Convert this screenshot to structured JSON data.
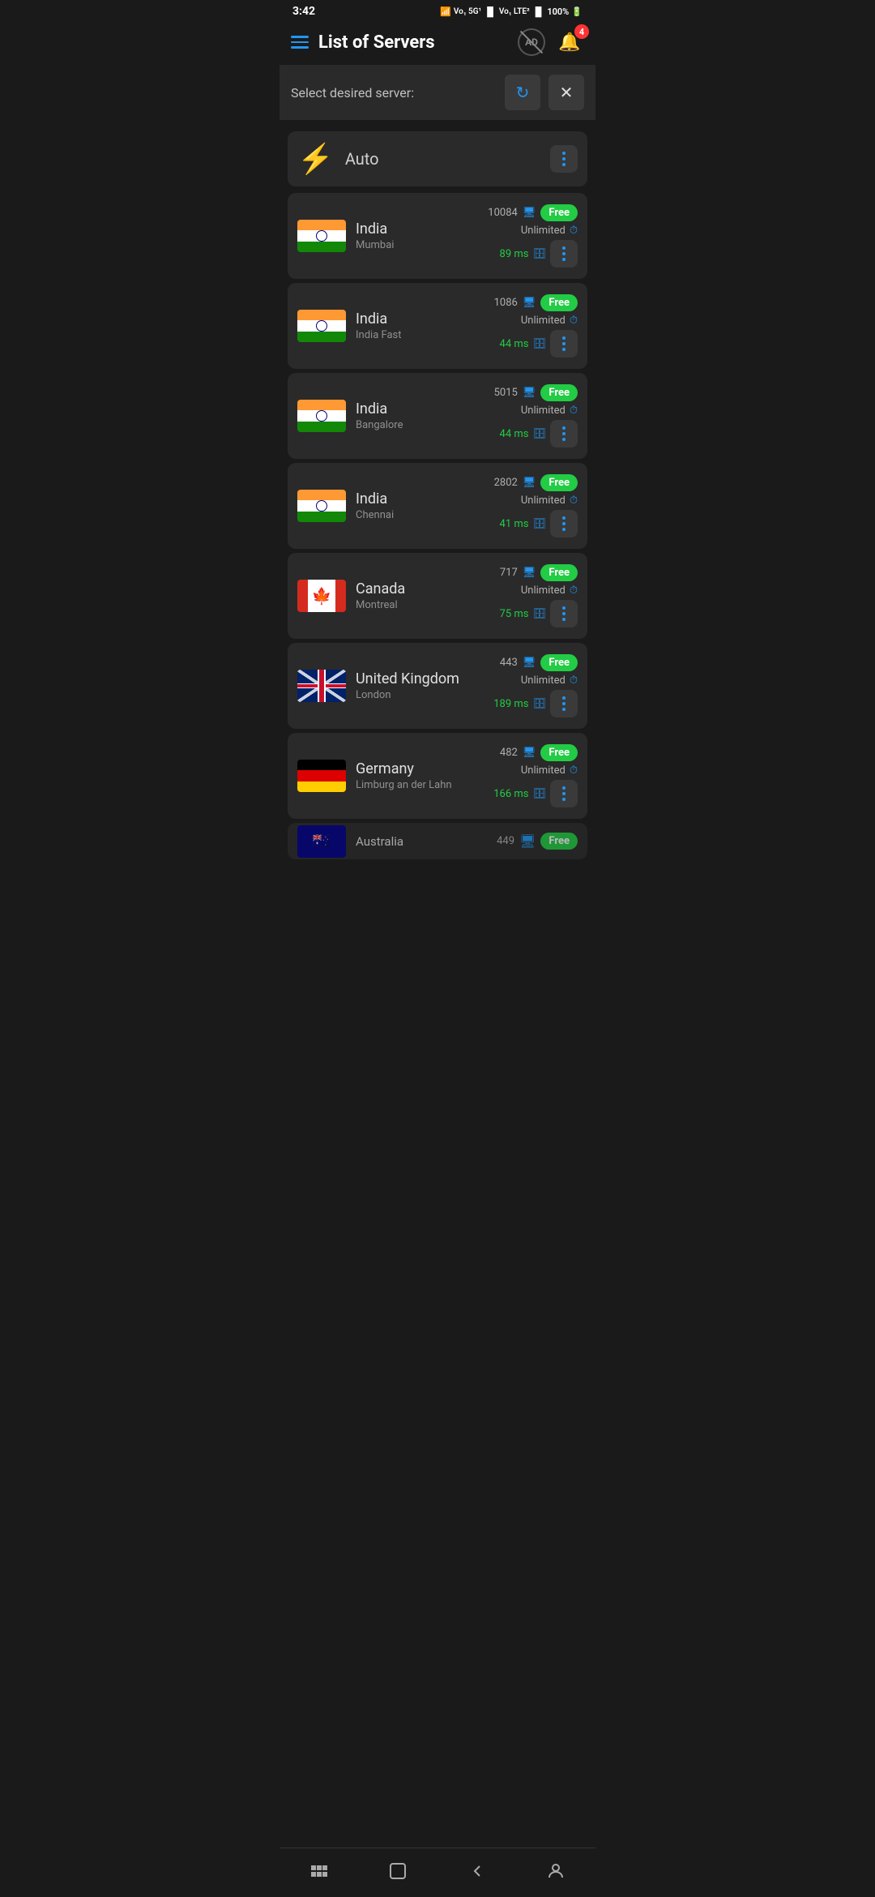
{
  "statusBar": {
    "time": "3:42",
    "battery": "100%"
  },
  "header": {
    "title": "List of Servers",
    "bellBadge": "4"
  },
  "subHeader": {
    "label": "Select desired server:"
  },
  "autoServer": {
    "label": "Auto"
  },
  "servers": [
    {
      "country": "India",
      "city": "Mumbai",
      "users": "10084",
      "bandwidth": "Unlimited",
      "ping": "89 ms",
      "badge": "Free",
      "flag": "india"
    },
    {
      "country": "India",
      "city": "India Fast",
      "users": "1086",
      "bandwidth": "Unlimited",
      "ping": "44 ms",
      "badge": "Free",
      "flag": "india"
    },
    {
      "country": "India",
      "city": "Bangalore",
      "users": "5015",
      "bandwidth": "Unlimited",
      "ping": "44 ms",
      "badge": "Free",
      "flag": "india"
    },
    {
      "country": "India",
      "city": "Chennai",
      "users": "2802",
      "bandwidth": "Unlimited",
      "ping": "41 ms",
      "badge": "Free",
      "flag": "india"
    },
    {
      "country": "Canada",
      "city": "Montreal",
      "users": "717",
      "bandwidth": "Unlimited",
      "ping": "75 ms",
      "badge": "Free",
      "flag": "canada"
    },
    {
      "country": "United Kingdom",
      "city": "London",
      "users": "443",
      "bandwidth": "Unlimited",
      "ping": "189 ms",
      "badge": "Free",
      "flag": "uk"
    },
    {
      "country": "Germany",
      "city": "Limburg an der Lahn",
      "users": "482",
      "bandwidth": "Unlimited",
      "ping": "166 ms",
      "badge": "Free",
      "flag": "germany"
    }
  ],
  "partialServer": {
    "country": "Australia",
    "users": "449",
    "badge": "Free",
    "flag": "australia"
  },
  "bottomNav": {
    "items": [
      "menu",
      "home",
      "back",
      "person"
    ]
  }
}
